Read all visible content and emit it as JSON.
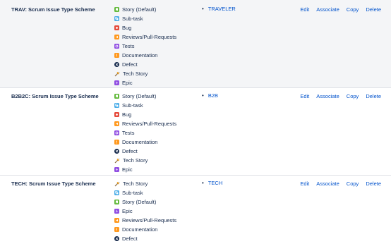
{
  "actions": {
    "edit": "Edit",
    "associate": "Associate",
    "copy": "Copy",
    "delete": "Delete"
  },
  "schemes": [
    {
      "name": "TRAV: Scrum Issue Type Scheme",
      "project": "TRAVELER",
      "types": [
        {
          "label": "Story (Default)",
          "icon": "story-icon",
          "color": "#63ba3c"
        },
        {
          "label": "Sub-task",
          "icon": "subtask-icon",
          "color": "#4bade8"
        },
        {
          "label": "Bug",
          "icon": "bug-icon",
          "color": "#e5493a"
        },
        {
          "label": "Reviews/Pull-Requests",
          "icon": "review-icon",
          "color": "#ff991f"
        },
        {
          "label": "Tests",
          "icon": "tests-icon",
          "color": "#904ee2"
        },
        {
          "label": "Documentation",
          "icon": "documentation-icon",
          "color": "#ff991f"
        },
        {
          "label": "Defect",
          "icon": "defect-icon",
          "color": "#172b4d"
        },
        {
          "label": "Tech Story",
          "icon": "tech-story-icon",
          "color": "#ff991f"
        },
        {
          "label": "Epic",
          "icon": "epic-icon",
          "color": "#904ee2"
        }
      ]
    },
    {
      "name": "B2B2C: Scrum Issue Type Scheme",
      "project": "B2B",
      "types": [
        {
          "label": "Story (Default)",
          "icon": "story-icon",
          "color": "#63ba3c"
        },
        {
          "label": "Sub-task",
          "icon": "subtask-icon",
          "color": "#4bade8"
        },
        {
          "label": "Bug",
          "icon": "bug-icon",
          "color": "#e5493a"
        },
        {
          "label": "Reviews/Pull-Requests",
          "icon": "review-icon",
          "color": "#ff991f"
        },
        {
          "label": "Tests",
          "icon": "tests-icon",
          "color": "#904ee2"
        },
        {
          "label": "Documentation",
          "icon": "documentation-icon",
          "color": "#ff991f"
        },
        {
          "label": "Defect",
          "icon": "defect-icon",
          "color": "#172b4d"
        },
        {
          "label": "Tech Story",
          "icon": "tech-story-icon",
          "color": "#ff991f"
        },
        {
          "label": "Epic",
          "icon": "epic-icon",
          "color": "#904ee2"
        }
      ]
    },
    {
      "name": "TECH: Scrum Issue Type Scheme",
      "project": "TECH",
      "types": [
        {
          "label": "Tech Story",
          "icon": "tech-story-icon",
          "color": "#ff991f"
        },
        {
          "label": "Sub-task",
          "icon": "subtask-icon",
          "color": "#4bade8"
        },
        {
          "label": "Story (Default)",
          "icon": "story-icon",
          "color": "#63ba3c"
        },
        {
          "label": "Epic",
          "icon": "epic-icon",
          "color": "#904ee2"
        },
        {
          "label": "Reviews/Pull-Requests",
          "icon": "review-icon",
          "color": "#ff991f"
        },
        {
          "label": "Documentation",
          "icon": "documentation-icon",
          "color": "#ff991f"
        },
        {
          "label": "Defect",
          "icon": "defect-icon",
          "color": "#172b4d"
        }
      ]
    }
  ]
}
